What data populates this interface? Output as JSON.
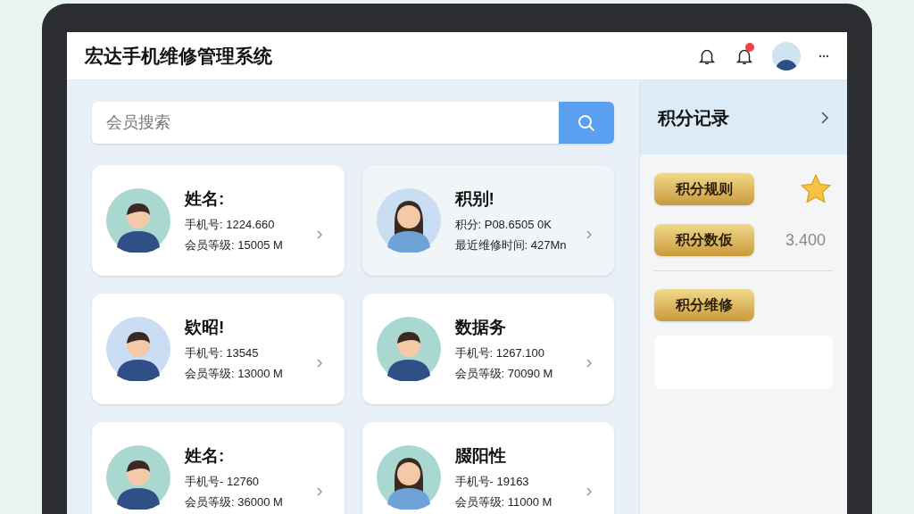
{
  "header": {
    "title": "宏达手机维修管理系统",
    "notification_unread": true
  },
  "search": {
    "placeholder": "会员搜索"
  },
  "members": [
    {
      "name": "姓名:",
      "line_1": "手机号: 1224.660",
      "line_2": "会员等级: 15005 M",
      "kind": "man",
      "color": "#a8d8d0",
      "selected": false
    },
    {
      "name": "积别!",
      "line_1": "积分: P08.6505 0K",
      "line_2": "最近维修时间: 427Mn",
      "kind": "woman",
      "color": "#c9def2",
      "selected": true
    },
    {
      "name": "欵昭!",
      "line_1": "手机号: 13545",
      "line_2": "会员等级: 13000 M",
      "kind": "man",
      "color": "#c9def2",
      "selected": false
    },
    {
      "name": "数据务",
      "line_1": "手机号: 1267.100",
      "line_2": "会员等级: 70090 M",
      "kind": "man",
      "color": "#a8d8d0",
      "selected": false
    },
    {
      "name": "姓名:",
      "line_1": "手机号- 12760",
      "line_2": "会员等级: 36000 M",
      "kind": "man",
      "color": "#a8d8d0",
      "selected": false
    },
    {
      "name": "腏阳性",
      "line_1": "手机号- 19163",
      "line_2": "会员等级: 11000 M",
      "kind": "woman",
      "color": "#a8d8d0",
      "selected": false
    }
  ],
  "points_panel": {
    "title": "积分记录",
    "ribbons": [
      {
        "label": "积分规则",
        "kind": "star"
      },
      {
        "label": "积分数仮",
        "kind": "value",
        "value": "3.400"
      },
      {
        "label": "积分维修",
        "kind": "card"
      }
    ]
  }
}
